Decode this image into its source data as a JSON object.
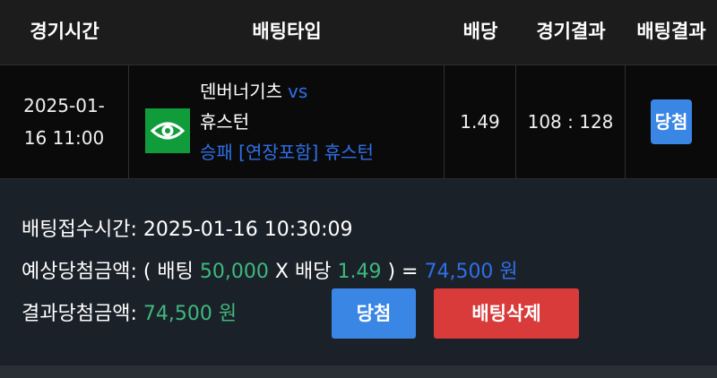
{
  "header": {
    "col_time": "경기시간",
    "col_type": "배팅타입",
    "col_odds": "배당",
    "col_game_result": "경기결과",
    "col_bet_result": "배팅결과"
  },
  "row": {
    "time": "2025-01-16 11:00",
    "home_team": "덴버너기츠",
    "vs": "vs",
    "away_team": "휴스턴",
    "bet_type": "승패 [연장포함] 휴스턴",
    "odds": "1.49",
    "score": "108 : 128",
    "result_badge": "당첨",
    "icon": "eye-icon"
  },
  "details": {
    "accept_time_label": "배팅접수시간:",
    "accept_time_value": "2025-01-16 10:30:09",
    "expected_label": "예상당첨금액:",
    "open_paren": "( 배팅",
    "stake": "50,000",
    "times_odds": "X 배당",
    "odds": "1.49",
    "close_paren_eq": ") =",
    "expected_value": "74,500 원",
    "result_label": "결과당첨금액:",
    "result_value": "74,500 원"
  },
  "buttons": {
    "win": "당첨",
    "delete": "배팅삭제"
  },
  "colors": {
    "accent_blue": "#3a86e5",
    "text_blue": "#2f6fe8",
    "green": "#3fb87f",
    "danger": "#d93a3a",
    "icon_green": "#119c3c"
  }
}
